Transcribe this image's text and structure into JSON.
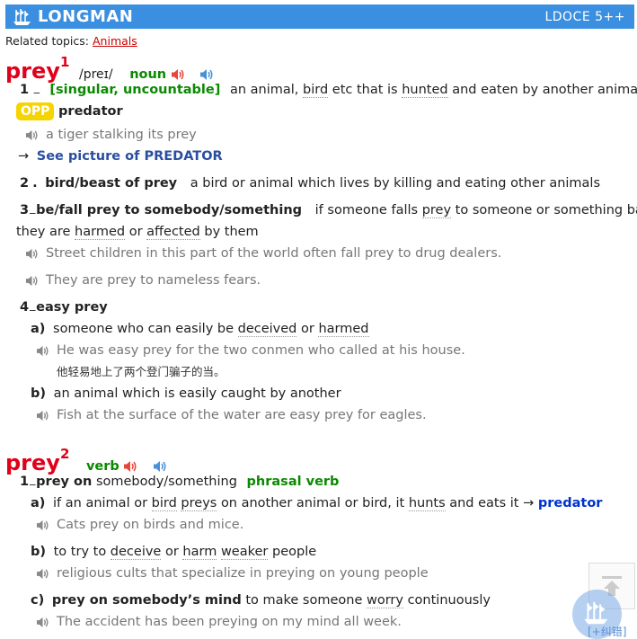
{
  "header": {
    "brand": "LONGMAN",
    "edition": "LDOCE 5++"
  },
  "related": {
    "label": "Related topics:",
    "topic": "Animals"
  },
  "entry1": {
    "headword": "prey",
    "homnum": "1",
    "pron": "/preɪ/",
    "pos": "noun",
    "senses": {
      "s1": {
        "num": "1",
        "dash": "⚊",
        "gram": "[singular, uncountable]",
        "def_a": "an animal,",
        "def_link1": "bird",
        "def_b": "etc that is",
        "def_link2": "hunted",
        "def_c": "and eaten by another animal",
        "opp_label": "OPP",
        "opp_word": "predator",
        "example": "a tiger stalking its prey",
        "xref_arrow": "→",
        "xref": "See picture of PREDATOR"
      },
      "s2": {
        "num": "2",
        "dot": ".",
        "lex": "bird/beast of prey",
        "def_a": "a bird or animal which lives by killing and eating other animals"
      },
      "s3": {
        "num": "3",
        "dash": "⚊",
        "lex": "be/fall prey to somebody/something",
        "def_a": "if someone falls",
        "def_link1": "prey",
        "def_b": "to someone or something bad,",
        "def_c": "they are",
        "def_link2": "harmed",
        "def_d": "or",
        "def_link3": "affected",
        "def_e": "by them",
        "ex1": "Street children in this part of the world often fall prey to drug dealers.",
        "ex2": "They are prey to nameless fears."
      },
      "s4": {
        "num": "4",
        "dash": "⚊",
        "lex": "easy prey",
        "a": {
          "letter": "a)",
          "def_a": "someone who can easily be",
          "link1": "deceived",
          "def_b": "or",
          "link2": "harmed",
          "ex": "He was easy prey for the two conmen who called at his house.",
          "ex_cn": "他轻易地上了两个登门骗子的当。"
        },
        "b": {
          "letter": "b)",
          "def": "an animal which is easily caught by another",
          "ex": "Fish at the surface of the water are easy prey for eagles."
        }
      }
    }
  },
  "entry2": {
    "headword": "prey",
    "homnum": "2",
    "pos": "verb",
    "pv": {
      "num": "1",
      "dash": "⚊",
      "lex": "prey on",
      "obj": "somebody/something",
      "label": "phrasal verb",
      "a": {
        "letter": "a)",
        "def_a": "if an animal or",
        "link1": "bird",
        "link2": "preys",
        "def_b": "on another animal or bird, it",
        "link3": "hunts",
        "def_c": "and eats it",
        "arrow": "→",
        "xref": "predator",
        "ex": "Cats prey on birds and mice."
      },
      "b": {
        "letter": "b)",
        "def_a": "to try to",
        "link1": "deceive",
        "def_b": "or",
        "link2": "harm",
        "link3": "weaker",
        "def_c": "people",
        "ex": "religious cults that specialize in preying on young people"
      },
      "c": {
        "letter": "c)",
        "lex": "prey on somebody’s mind",
        "def_a": "to make someone",
        "link1": "worry",
        "def_b": "continuously",
        "ex": "The accident has been preying on my mind all week."
      }
    }
  },
  "footer": {
    "error_link": "[+纠错]"
  },
  "icons": {
    "speaker_red": "#e8453c",
    "speaker_blue": "#4a90d9",
    "speaker_grey": "#888888"
  }
}
